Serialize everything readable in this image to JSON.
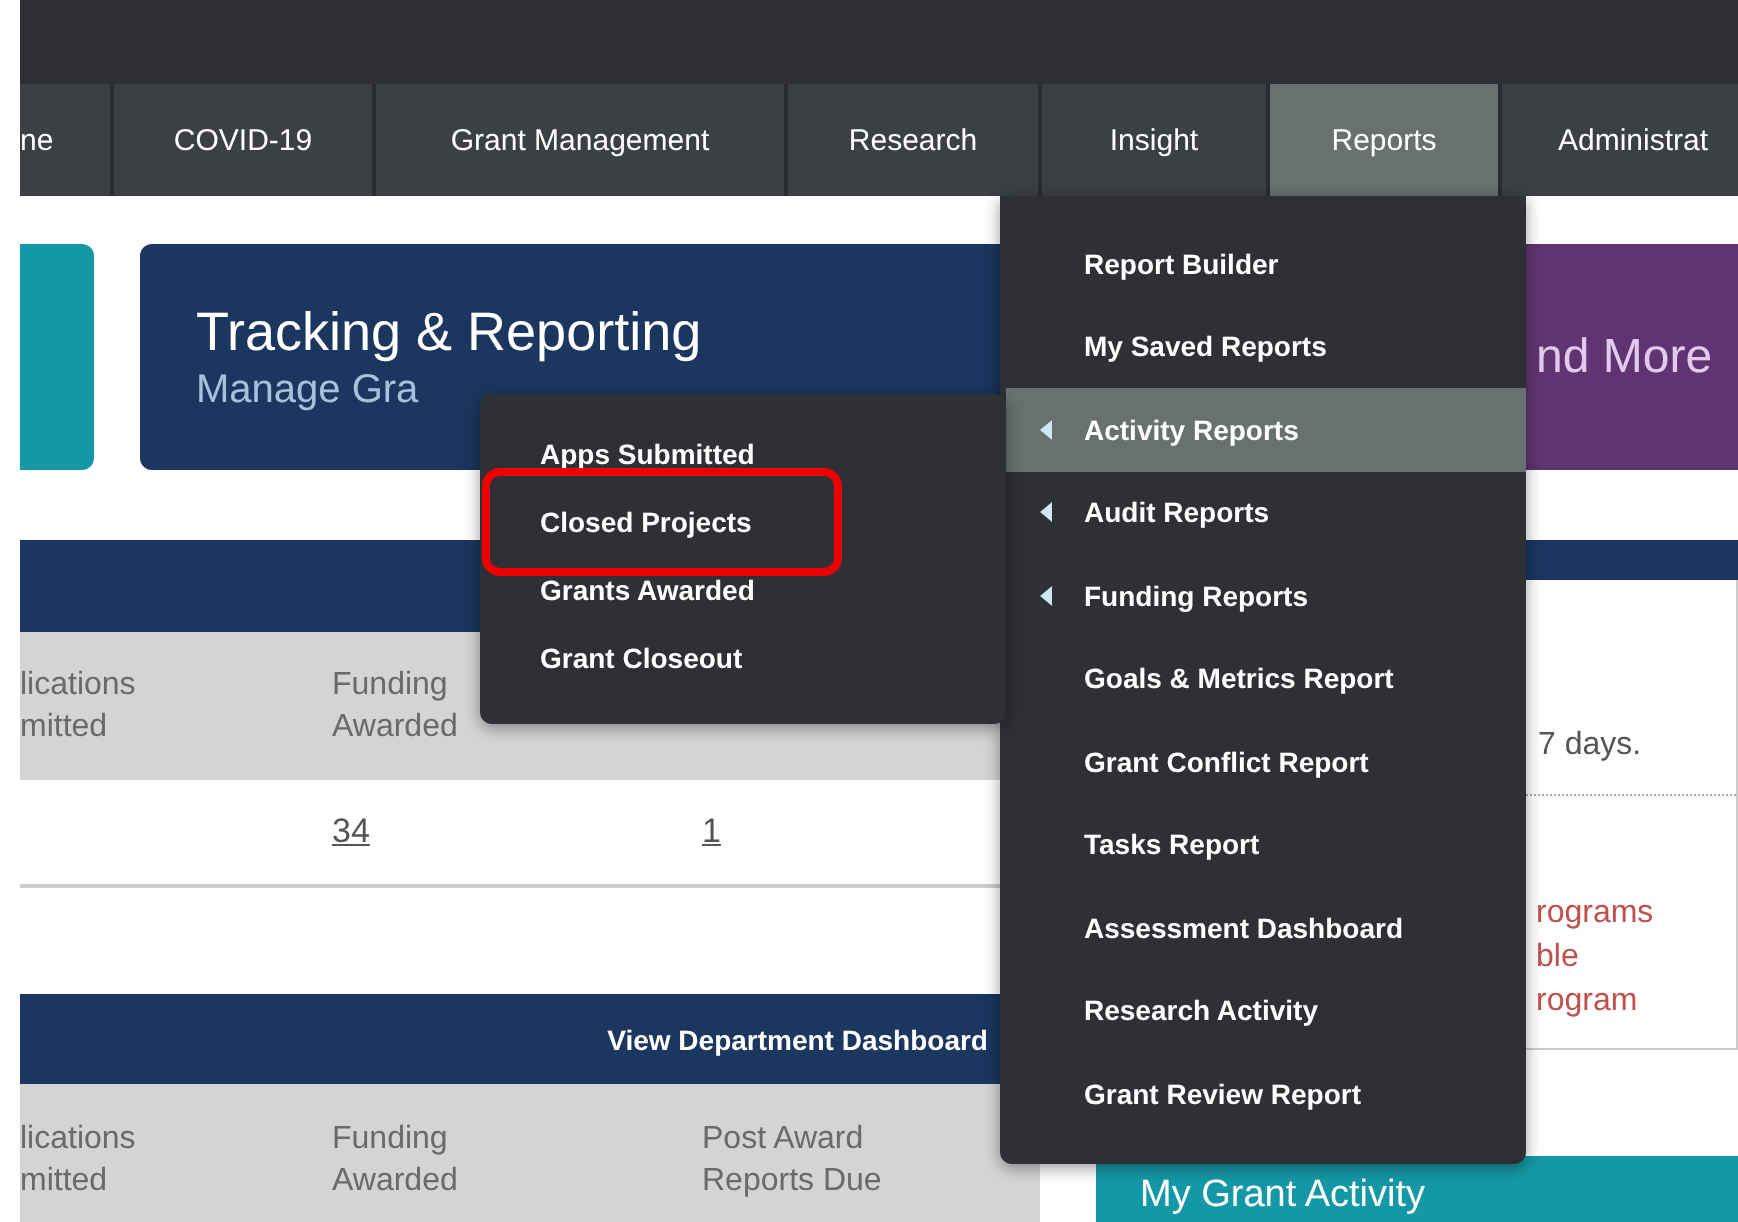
{
  "nav": {
    "tabs": [
      {
        "label": "ne",
        "selected": false
      },
      {
        "label": "COVID-19",
        "selected": false
      },
      {
        "label": "Grant Management",
        "selected": false
      },
      {
        "label": "Research",
        "selected": false
      },
      {
        "label": "Insight",
        "selected": false
      },
      {
        "label": "Reports",
        "selected": true
      },
      {
        "label": "Administrat",
        "selected": false
      }
    ]
  },
  "cards": [
    {
      "color": "#1598a6"
    },
    {
      "color": "#1b365f",
      "title": "Tracking & Reporting",
      "subtitle": "Manage Gra"
    },
    {
      "color": "#5f3470",
      "title": "nd More"
    }
  ],
  "table_1": {
    "columns": [
      {
        "header_lines": [
          "lications",
          "mitted"
        ]
      },
      {
        "header_lines": [
          "Funding",
          "Awarded"
        ],
        "value": "34"
      },
      {
        "value": "1"
      }
    ]
  },
  "table_2": {
    "link": "View Department Dashboard",
    "columns": [
      {
        "header_lines": [
          "lications",
          "mitted"
        ]
      },
      {
        "header_lines": [
          "Funding",
          "Awarded"
        ]
      },
      {
        "header_lines": [
          "Post Award",
          "Reports Due"
        ]
      }
    ]
  },
  "side_panel": {
    "note": "7 days.",
    "links": [
      "rograms",
      "ble",
      "rogram"
    ],
    "activity_title": "My Grant Activity"
  },
  "reports_menu": {
    "items": [
      {
        "label": "Report Builder",
        "has_submenu": false,
        "selected": false
      },
      {
        "label": "My Saved Reports",
        "has_submenu": false,
        "selected": false
      },
      {
        "label": "Activity Reports",
        "has_submenu": true,
        "selected": true
      },
      {
        "label": "Audit Reports",
        "has_submenu": true,
        "selected": false
      },
      {
        "label": "Funding Reports",
        "has_submenu": true,
        "selected": false
      },
      {
        "label": "Goals & Metrics Report",
        "has_submenu": false,
        "selected": false
      },
      {
        "label": "Grant Conflict Report",
        "has_submenu": false,
        "selected": false
      },
      {
        "label": "Tasks Report",
        "has_submenu": false,
        "selected": false
      },
      {
        "label": "Assessment Dashboard",
        "has_submenu": false,
        "selected": false
      },
      {
        "label": "Research Activity",
        "has_submenu": false,
        "selected": false
      },
      {
        "label": "Grant Review Report",
        "has_submenu": false,
        "selected": false
      }
    ]
  },
  "activity_submenu": {
    "items": [
      {
        "label": "Apps Submitted",
        "highlighted": false
      },
      {
        "label": "Closed Projects",
        "highlighted": true
      },
      {
        "label": "Grants Awarded",
        "highlighted": false
      },
      {
        "label": "Grant Closeout",
        "highlighted": false
      }
    ]
  }
}
